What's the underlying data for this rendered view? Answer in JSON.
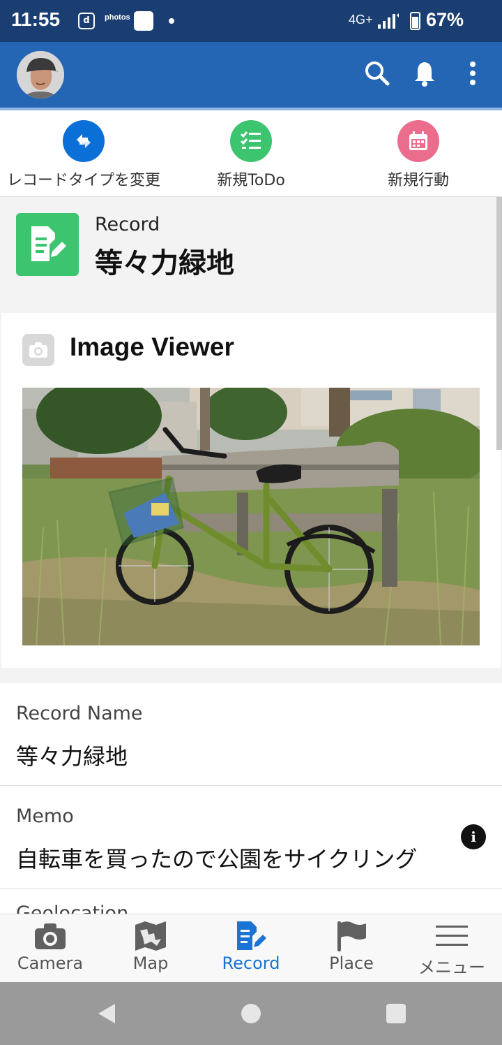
{
  "status_bar": {
    "time": "11:55",
    "d_icon": "d",
    "photos_label": "photos",
    "network": "4G+",
    "battery": "67%"
  },
  "header": {
    "avatar": "avatar",
    "search_icon": "search-icon",
    "bell_icon": "bell-icon",
    "more_icon": "more-vertical-icon",
    "color": "#2566b4"
  },
  "actions": [
    {
      "label": "レコードタイプを変更",
      "icon": "change-record-type-icon",
      "color": "#0a6fd6"
    },
    {
      "label": "新規ToDo",
      "icon": "todo-list-icon",
      "color": "#3cc46f"
    },
    {
      "label": "新規行動",
      "icon": "calendar-icon",
      "color": "#ea6d8e"
    }
  ],
  "record": {
    "type": "Record",
    "title": "等々力緑地",
    "icon_color": "#3cc46f"
  },
  "viewer": {
    "title": "Image Viewer",
    "image": "photo of a green bicycle with a front basket parked in tall grass in front of a wooden park bench"
  },
  "fields": [
    {
      "label": "Record Name",
      "value": "等々力緑地"
    },
    {
      "label": "Memo",
      "value": "自転車を買ったので公園をサイクリング"
    },
    {
      "label": "Geolocation",
      "value": ""
    }
  ],
  "tabs": [
    {
      "label": "Camera",
      "icon": "camera-icon",
      "active": false
    },
    {
      "label": "Map",
      "icon": "map-icon",
      "active": false
    },
    {
      "label": "Record",
      "icon": "record-icon",
      "active": true
    },
    {
      "label": "Place",
      "icon": "flag-icon",
      "active": false
    },
    {
      "label": "メニュー",
      "icon": "menu-icon",
      "active": false
    }
  ],
  "accent_color": "#1b73d3"
}
